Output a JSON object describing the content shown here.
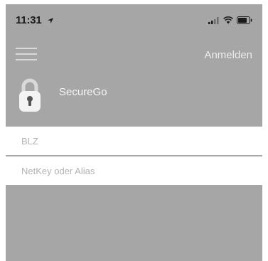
{
  "status_bar": {
    "time": "11:31",
    "icons": [
      "location-arrow-icon",
      "signal-icon",
      "wifi-icon",
      "battery-icon"
    ]
  },
  "nav": {
    "menu_icon": "hamburger-menu-icon",
    "login_label": "Anmelden"
  },
  "app": {
    "logo_icon": "lock-icon",
    "name": "SecureGo"
  },
  "form": {
    "blz_placeholder": "BLZ",
    "blz_value": "",
    "netkey_placeholder": "NetKey oder Alias",
    "netkey_value": ""
  },
  "colors": {
    "overlay_background": "#a6a6a6",
    "field_background": "#ffffff",
    "placeholder_text": "#b3b3b3",
    "light_text": "#ececec"
  }
}
